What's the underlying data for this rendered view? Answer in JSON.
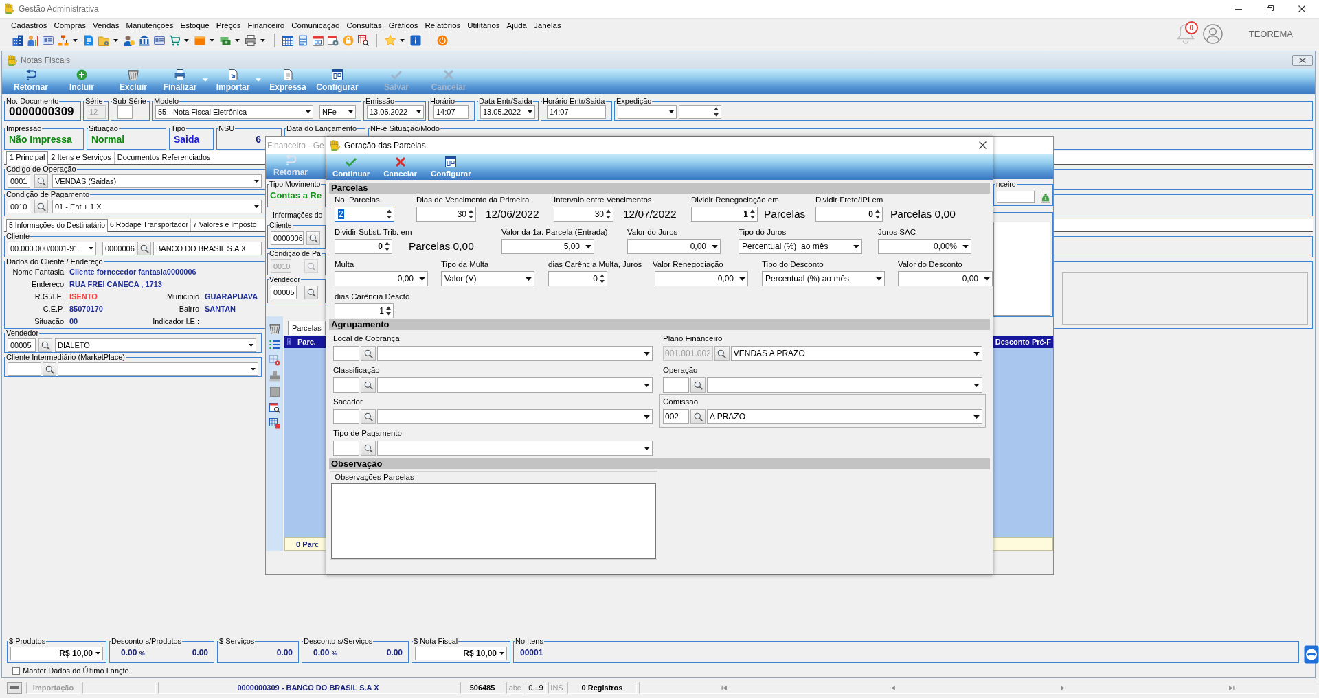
{
  "app": {
    "title": "Gestão Administrativa",
    "menu": [
      "Cadastros",
      "Compras",
      "Vendas",
      "Manutenções",
      "Estoque",
      "Preços",
      "Financeiro",
      "Comunicação",
      "Consultas",
      "Gráficos",
      "Relatórios",
      "Utilitários",
      "Ajuda",
      "Janelas"
    ],
    "notification_count": "0",
    "user_name": "TEOREMA"
  },
  "notas_fiscais": {
    "title": "Notas Fiscais",
    "toolbar": [
      {
        "label": "Retornar",
        "kind": "back",
        "disabled": false,
        "dropdown": false
      },
      {
        "label": "Incluir",
        "kind": "add",
        "disabled": false,
        "dropdown": false
      },
      {
        "label": "Excluir",
        "kind": "delete",
        "disabled": false,
        "dropdown": false
      },
      {
        "label": "Finalizar",
        "kind": "print",
        "disabled": false,
        "dropdown": true
      },
      {
        "label": "Importar",
        "kind": "import",
        "disabled": false,
        "dropdown": true
      },
      {
        "label": "Expressa",
        "kind": "express",
        "disabled": false,
        "dropdown": false
      },
      {
        "label": "Configurar",
        "kind": "configure",
        "disabled": false,
        "dropdown": false
      },
      {
        "label": "Salvar",
        "kind": "save",
        "disabled": true,
        "dropdown": false
      },
      {
        "label": "Cancelar",
        "kind": "cancel",
        "disabled": true,
        "dropdown": false
      }
    ],
    "document_row": [
      {
        "label": "No. Documento",
        "controls": [
          {
            "kind": "display",
            "value": "0000000309",
            "disabled": false
          }
        ]
      },
      {
        "label": "Série",
        "controls": [
          {
            "kind": "text",
            "value": "12",
            "disabled": true
          }
        ]
      },
      {
        "label": "Sub-Série",
        "controls": [
          {
            "kind": "text",
            "disabled": false
          }
        ]
      },
      {
        "label": "Modelo",
        "controls": [
          {
            "kind": "select",
            "value": "55 - Nota Fiscal Eletrônica",
            "disabled": false
          },
          {
            "kind": "select",
            "value": "NFe",
            "disabled": false
          }
        ]
      },
      {
        "label": "Emissão",
        "controls": [
          {
            "kind": "select",
            "value": "13.05.2022",
            "disabled": false
          }
        ]
      },
      {
        "label": "Horário",
        "controls": [
          {
            "kind": "text",
            "value": "14:07",
            "disabled": false
          }
        ]
      },
      {
        "label": "Data Entr/Saida",
        "controls": [
          {
            "kind": "select",
            "value": "13.05.2022",
            "disabled": false
          }
        ]
      },
      {
        "label": "Horário Entr/Saida",
        "controls": [
          {
            "kind": "text",
            "value": "14:07",
            "disabled": false
          }
        ]
      },
      {
        "label": "Expedição",
        "controls": [
          {
            "kind": "select",
            "disabled": false
          },
          {
            "kind": "spin",
            "disabled": false
          }
        ]
      }
    ],
    "status_row": [
      {
        "label": "Impressão",
        "value": "Não Impressa",
        "color": "#0a8a0a"
      },
      {
        "label": "Situação",
        "value": "Normal",
        "color": "#0a8a0a"
      },
      {
        "label": "Tipo",
        "value": "Saida",
        "color": "#1c1cd6"
      },
      {
        "label": "NSU",
        "value": "6",
        "color": "#1a237e"
      },
      {
        "label": "Data do Lançamento"
      },
      {
        "label": "NF-e Situação/Modo"
      }
    ],
    "tabs": [
      {
        "label": "1 Principal",
        "selected": true
      },
      {
        "label": "2 Itens e Serviços",
        "selected": false
      },
      {
        "label": "Documentos Referenciados",
        "selected": false
      }
    ],
    "operacao": {
      "label": "Código de Operação",
      "code": "0001",
      "value": "VENDAS (Saidas)"
    },
    "pagamento": {
      "label": "Condição de Pagamento",
      "code": "0010",
      "value": "01 - Ent + 1 X"
    },
    "sub_tabs": [
      {
        "label": "5 Informações do Destinatário",
        "selected": true
      },
      {
        "label": "6 Rodapé Transportador",
        "selected": false
      },
      {
        "label": "7 Valores e Imposto",
        "selected": false
      }
    ],
    "cliente": {
      "label": "Cliente",
      "document": "00.000.000/0001-91",
      "code": "0000006",
      "name": "BANCO DO BRASIL S.A X"
    },
    "dados_cliente": {
      "label": "Dados do Cliente / Endereço",
      "rows": [
        [
          {
            "label": "Nome Fantasia",
            "value": "Cliente fornecedor fantasia0000006",
            "color": "#1f2f96"
          }
        ],
        [
          {
            "label": "Endereço",
            "value": "RUA FREI CANECA , 1713",
            "color": "#1f2f96"
          }
        ],
        [
          {
            "label": "R.G./I.E.",
            "value": "ISENTO",
            "color": "#ff3b3b"
          },
          {
            "label": "Município",
            "value": "GUARAPUAVA",
            "color": "#1f2f96"
          }
        ],
        [
          {
            "label": "C.E.P.",
            "value": "85070170",
            "color": "#1f2f96"
          },
          {
            "label": "Bairro",
            "value": "SANTAN",
            "color": "#1f2f96"
          }
        ],
        [
          {
            "label": "Situação",
            "value": "00",
            "color": "#1f2f96"
          },
          {
            "label": "Indicador I.E.:"
          }
        ]
      ]
    },
    "vendedor": {
      "label": "Vendedor",
      "code": "00005",
      "value": "DIALETO"
    },
    "intermediario": {
      "label": "Cliente Intermediário (MarketPlace)"
    },
    "totals": [
      {
        "label": "$ Produtos",
        "kind": "select",
        "value": "R$ 10,00"
      },
      {
        "label": "Desconto s/Produtos",
        "kind": "discount",
        "percent": "0.00",
        "unit": "%",
        "value": "0.00"
      },
      {
        "label": "$ Serviços",
        "kind": "amount",
        "value": "0.00"
      },
      {
        "label": "Desconto s/Serviços",
        "kind": "discount",
        "percent": "0.00",
        "unit": "%",
        "value": "0.00"
      },
      {
        "label": "$ Nota Fiscal",
        "kind": "select",
        "value": "R$ 10,00"
      },
      {
        "label": "No Itens",
        "kind": "count",
        "value": "00001"
      }
    ],
    "keep_data": {
      "label": "Manter Dados do Último Lançto",
      "checked": false
    }
  },
  "financeiro": {
    "title": "Financeiro - Ge",
    "toolbar": [
      {
        "label": "Retornar",
        "kind": "back",
        "disabled": true
      }
    ],
    "tipo_movimento": {
      "label": "Tipo Movimento",
      "value": "Contas a Re"
    },
    "section_label": "Informações do",
    "lookups": [
      {
        "label": "Cliente",
        "code": "0000006",
        "disabled": false
      },
      {
        "label": "Condição de Pa",
        "code": "0010",
        "disabled": true
      },
      {
        "label": "Vendedor",
        "code": "00005",
        "disabled": false
      }
    ],
    "plano_label": "nceiro",
    "tabs": [
      {
        "label": "Parcelas",
        "selected": true
      }
    ],
    "grid": {
      "columns": [
        "Parc.",
        "Desconto Pré-F"
      ],
      "footer": "0 Parc"
    }
  },
  "dialog": {
    "title": "Geração das Parcelas",
    "toolbar": [
      {
        "label": "Continuar",
        "kind": "confirm"
      },
      {
        "label": "Cancelar",
        "kind": "cancel"
      },
      {
        "label": "Configurar",
        "kind": "configure"
      }
    ],
    "parcelas": {
      "title": "Parcelas",
      "rows": [
        [
          {
            "label": "No. Parcelas",
            "kind": "spin",
            "value": "2",
            "bold": false,
            "focused": true
          },
          {
            "label": "Dias de Vencimento da Primeira",
            "kind": "spin",
            "value": "30",
            "bold": false,
            "focused": false,
            "note": "12/06/2022"
          },
          {
            "label": "Intervalo entre Vencimentos",
            "kind": "spin",
            "value": "30",
            "bold": false,
            "focused": false,
            "note": "12/07/2022"
          },
          {
            "label": "Dividir Renegociação em",
            "kind": "spin",
            "value": "1",
            "bold": true,
            "focused": false,
            "note": "Parcelas"
          },
          {
            "label": "Dividir Frete/IPI em",
            "kind": "spin",
            "value": "0",
            "bold": true,
            "focused": false,
            "note": "Parcelas 0,00"
          }
        ],
        [
          {
            "label": "Dividir Subst. Trib. em",
            "kind": "spin",
            "value": "0",
            "bold": true,
            "focused": false,
            "note": "Parcelas 0,00"
          },
          {
            "label": "Valor da 1a. Parcela (Entrada)",
            "kind": "number",
            "value": "5,00",
            "focused": false
          },
          {
            "label": "Valor do Juros",
            "kind": "number",
            "value": "0,00",
            "focused": false
          },
          {
            "label": "Tipo do Juros",
            "kind": "select",
            "value": "Percentual (%)  ao mês",
            "focused": false
          },
          {
            "label": "Juros SAC",
            "kind": "number",
            "value": "0,00%",
            "focused": false
          }
        ],
        [
          {
            "label": "Multa",
            "kind": "number",
            "value": "0,00",
            "focused": false
          },
          {
            "label": "Tipo da Multa",
            "kind": "select",
            "value": "Valor (V)",
            "focused": false
          },
          {
            "label": "dias Carência Multa, Juros",
            "kind": "spin",
            "value": "0",
            "bold": false,
            "focused": false
          },
          {
            "label": "Valor Renegociação",
            "kind": "number",
            "value": "0,00",
            "focused": false
          },
          {
            "label": "Tipo do Desconto",
            "kind": "select",
            "value": "Percentual (%) ao mês",
            "focused": false
          },
          {
            "label": "Valor do Desconto",
            "kind": "number",
            "value": "0,00",
            "focused": false
          }
        ],
        [
          {
            "label": "dias Carência Descto",
            "kind": "spin",
            "value": "1",
            "bold": false,
            "focused": false
          }
        ]
      ]
    },
    "agrupamento": {
      "title": "Agrupamento",
      "columns": [
        [
          {
            "label": "Local de Cobrança",
            "kind": "plain",
            "disabled": false
          },
          {
            "label": "Classificação",
            "kind": "plain",
            "disabled": false
          },
          {
            "label": "Sacador",
            "kind": "plain",
            "disabled": false
          },
          {
            "label": "Tipo de Pagamento",
            "kind": "plain",
            "disabled": false
          }
        ],
        [
          {
            "label": "Plano Financeiro",
            "kind": "plain",
            "code": "001.001.002",
            "value": "VENDAS A PRAZO",
            "disabled": true
          },
          {
            "label": "Operação",
            "kind": "plain",
            "disabled": false
          },
          {
            "label": "Comissão",
            "kind": "framed",
            "code": "002",
            "value": "A PRAZO",
            "disabled": false
          }
        ]
      ]
    },
    "observacao": {
      "title": "Observação",
      "box_label": "Observações Parcelas"
    }
  },
  "status_bar": {
    "items": [
      {
        "text": "Importação",
        "disabled": true
      },
      {
        "text": "0000000309 - BANCO DO BRASIL S.A X",
        "disabled": false
      },
      {
        "text": "506485",
        "disabled": false
      },
      {
        "text": "abc",
        "disabled": true
      },
      {
        "text": "0...9",
        "disabled": false
      },
      {
        "text": "INS",
        "disabled": true
      },
      {
        "text": "0 Registros",
        "disabled": false
      }
    ]
  }
}
